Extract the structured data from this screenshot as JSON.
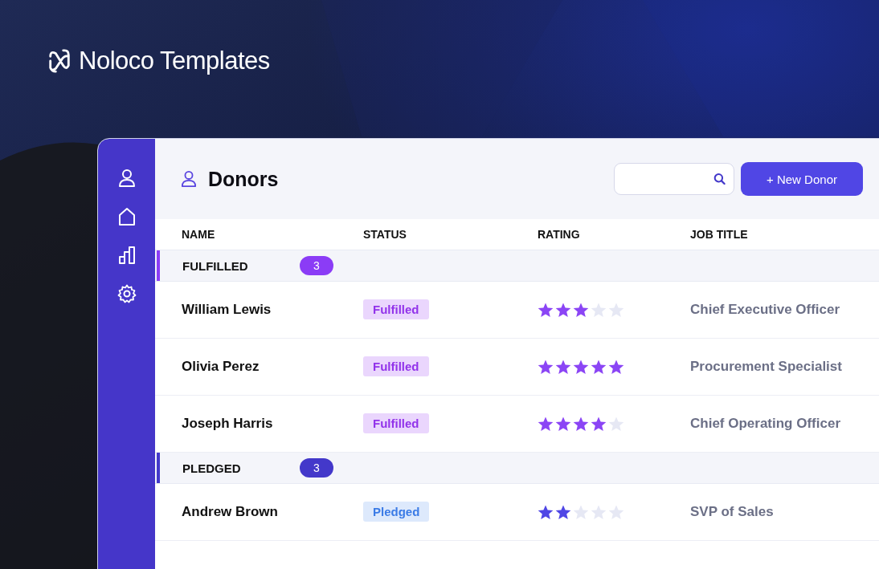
{
  "brand": {
    "name": "Noloco Templates"
  },
  "page": {
    "title": "Donors"
  },
  "new_button": {
    "label": "+ New Donor"
  },
  "table": {
    "columns": [
      "NAME",
      "STATUS",
      "RATING",
      "JOB TITLE"
    ],
    "groups": [
      {
        "label": "FULFILLED",
        "count": "3",
        "color": "#8b3cf6",
        "kind": "fulfilled",
        "rows": [
          {
            "name": "William Lewis",
            "status": "Fulfilled",
            "stars": 3,
            "job_title": "Chief Executive Officer"
          },
          {
            "name": "Olivia Perez",
            "status": "Fulfilled",
            "stars": 5,
            "job_title": "Procurement Specialist"
          },
          {
            "name": "Joseph Harris",
            "status": "Fulfilled",
            "stars": 4,
            "job_title": "Chief Operating Officer"
          }
        ]
      },
      {
        "label": "PLEDGED",
        "count": "3",
        "color": "#4338ca",
        "kind": "pledged",
        "rows": [
          {
            "name": "Andrew Brown",
            "status": "Pledged",
            "stars": 2,
            "job_title": "SVP of Sales"
          }
        ]
      }
    ]
  }
}
